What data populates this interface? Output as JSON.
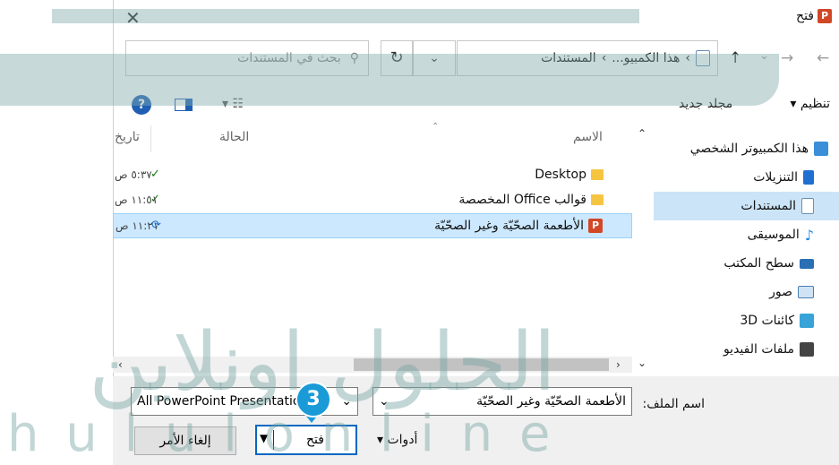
{
  "window": {
    "title": "فتح",
    "close_glyph": "✕"
  },
  "nav": {
    "back": "←",
    "forward": "→",
    "up": "↑",
    "recent": "⌄"
  },
  "address": {
    "parts": [
      "هذا الكمبيو...",
      "المستندات"
    ],
    "separator": "›"
  },
  "search": {
    "placeholder": "بحث في المستندات"
  },
  "toolbar": {
    "organize": "تنظيم",
    "new_folder": "مجلد جديد",
    "help": "?"
  },
  "sidebar": {
    "items": [
      {
        "label": "هذا الكمبيوتر الشخصي",
        "icon": "computer-icon",
        "color": "#3a8fd8"
      },
      {
        "label": "التنزيلات",
        "icon": "download-icon",
        "color": "#1e6fd0"
      },
      {
        "label": "المستندات",
        "icon": "document-icon",
        "color": "#6b8fb5"
      },
      {
        "label": "الموسيقى",
        "icon": "music-icon",
        "color": "#1e88e5"
      },
      {
        "label": "سطح المكتب",
        "icon": "desktop-icon",
        "color": "#2a6fb5"
      },
      {
        "label": "صور",
        "icon": "pictures-icon",
        "color": "#4a7fb0"
      },
      {
        "label": "كائنات 3D",
        "icon": "3d-objects-icon",
        "color": "#37a3d8"
      },
      {
        "label": "ملفات الفيديو",
        "icon": "video-icon",
        "color": "#444444"
      }
    ]
  },
  "columns": {
    "name": "الاسم",
    "status": "الحالة",
    "date": "تاريخ"
  },
  "files": [
    {
      "name": "Desktop",
      "icon": "folder-icon",
      "status": "✓",
      "date": "٥:٣٧ ص"
    },
    {
      "name": "قوالب Office المخصصة",
      "icon": "folder-icon",
      "status": "✓",
      "date": "١١:٥١ ص"
    },
    {
      "name": "الأطعمة الصحّيّة وغير الصحّيّة",
      "icon": "powerpoint-icon",
      "status": "⟳",
      "date": "١١:٢١ ص"
    }
  ],
  "footer": {
    "filename_label": "اسم الملف:",
    "filename_value": "الأطعمة الصحّيّة وغير الصحّيّة",
    "filetype_value": "All PowerPoint Presentations",
    "tools": "أدوات",
    "open": "فتح",
    "cancel": "إلغاء الأمر"
  },
  "annotation": {
    "step": "3"
  },
  "watermark": {
    "text": "الحلول اونلاين",
    "latin": "h u l u l o n l i n e"
  },
  "colors": {
    "selection": "#cce8ff",
    "accent": "#0067c0",
    "step_badge": "#1a9bd7"
  }
}
